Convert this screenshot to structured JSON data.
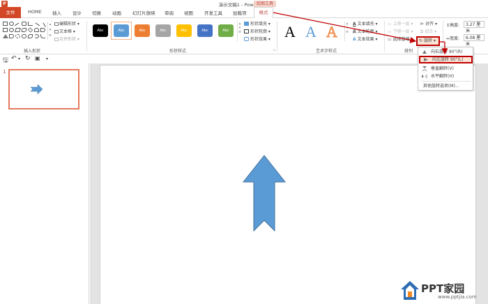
{
  "app": {
    "window_title": "演示文稿1 - PowerPoint",
    "context_tools_label": "绘图工具"
  },
  "tabs": [
    {
      "label": "文件"
    },
    {
      "label": "HOME"
    },
    {
      "label": "插入"
    },
    {
      "label": "设计"
    },
    {
      "label": "切换"
    },
    {
      "label": "动画"
    },
    {
      "label": "幻灯片放映"
    },
    {
      "label": "审阅"
    },
    {
      "label": "视图"
    },
    {
      "label": "开发工具"
    },
    {
      "label": "加载项"
    },
    {
      "label": "格式"
    }
  ],
  "ribbon": {
    "insert_shapes": {
      "label": "插入形状",
      "commands": [
        "编辑形状",
        "文本框",
        "合并形状"
      ]
    },
    "shape_styles": {
      "label": "形状样式",
      "swatch_text": "Abc",
      "swatches": [
        "#000000",
        "#5b9bd5",
        "#ed7d31",
        "#a5a5a5",
        "#ffc000",
        "#4472c4",
        "#70ad47"
      ],
      "commands": [
        "形状填充",
        "形状轮廓",
        "形状效果"
      ]
    },
    "wordart_styles": {
      "label": "艺术字样式",
      "letter": "A",
      "commands": [
        "文本填充",
        "文本轮廓",
        "文本效果"
      ]
    },
    "arrange": {
      "label": "排列",
      "commands": [
        "上移一层",
        "下移一层",
        "选择窗格",
        "对齐",
        "组合",
        "旋转"
      ]
    },
    "size": {
      "height_label": "高度:",
      "height_value": "3.27 厘米",
      "width_label": "宽度:",
      "width_value": "6.08 厘米"
    }
  },
  "rotate_menu": {
    "items": [
      {
        "label": "向右旋转 90°(R)",
        "highlighted": false
      },
      {
        "label": "向左旋转 90°(L)",
        "highlighted": true
      },
      {
        "label": "垂直翻转(V)",
        "highlighted": false
      },
      {
        "label": "水平翻转(H)",
        "highlighted": false
      },
      {
        "label": "其他旋转选项(M)...",
        "highlighted": false
      }
    ]
  },
  "slides": {
    "current_number": "1"
  },
  "watermark": {
    "brand": "PPT家园",
    "url": "www.pptjia.com"
  },
  "colors": {
    "file_tab": "#d24726",
    "arrow_fill": "#5b9bd5",
    "annotation_red": "#c00000"
  }
}
